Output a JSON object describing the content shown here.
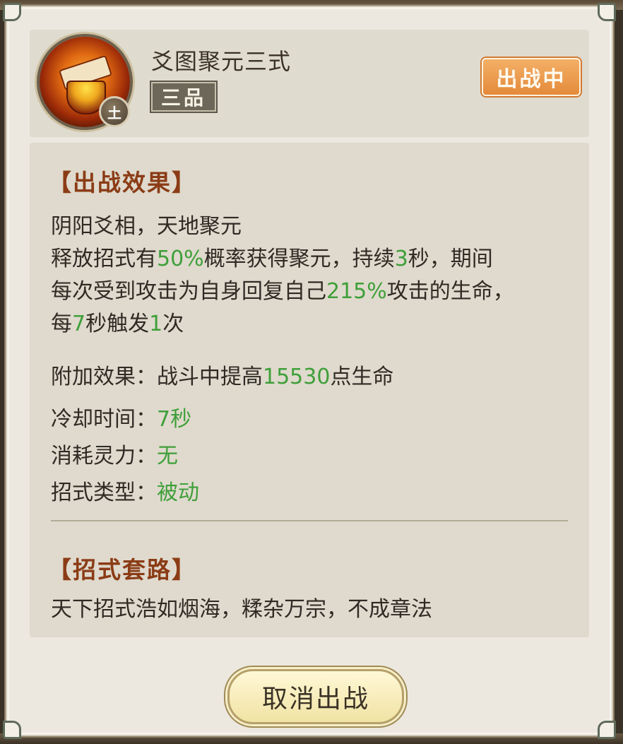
{
  "header": {
    "skill_name": "爻图聚元三式",
    "grade": "三品",
    "element": "土",
    "status": "出战中",
    "icon": "skill-scroll-bowl-icon"
  },
  "effect": {
    "title": "【出战效果】",
    "subtitle": "阴阳爻相，天地聚元",
    "line1_a": "释放招式有",
    "line1_v1": "50%",
    "line1_b": "概率获得聚元，持续",
    "line1_v2": "3",
    "line1_c": "秒，期间",
    "line2_a": "每次受到攻击为自身回复自己",
    "line2_v": "215%",
    "line2_b": "攻击的生命，",
    "line3_a": "每",
    "line3_v1": "7",
    "line3_b": "秒触发",
    "line3_v2": "1",
    "line3_c": "次",
    "bonus_label": "附加效果：战斗中提高",
    "bonus_value": "15530",
    "bonus_suffix": "点生命",
    "cooldown_label": "冷却时间：",
    "cooldown_value": "7秒",
    "cost_label": "消耗灵力：",
    "cost_value": "无",
    "type_label": "招式类型：",
    "type_value": "被动"
  },
  "routine": {
    "title": "【招式套路】",
    "text": "天下招式浩如烟海，糅杂万宗，不成章法"
  },
  "actions": {
    "cancel_label": "取消出战"
  },
  "colors": {
    "highlight": "#3f9f3a",
    "section_title": "#8b3c16",
    "status_badge": "#e48a3a"
  }
}
